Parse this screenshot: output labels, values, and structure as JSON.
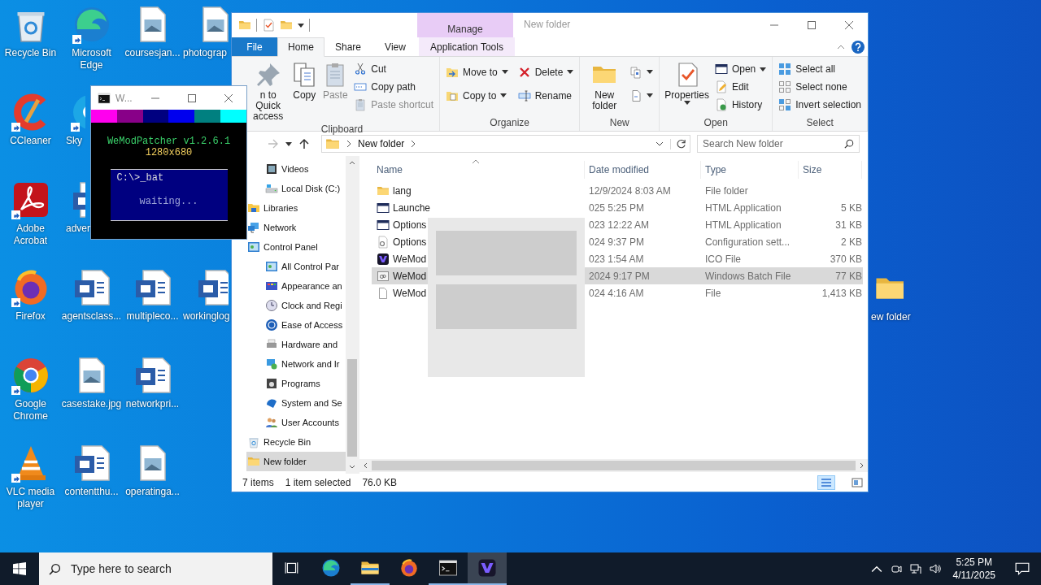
{
  "desktop": {
    "icons": [
      {
        "kind": "recycle",
        "label": "Recycle Bin",
        "shortcut": false
      },
      {
        "kind": "edge",
        "label": "Microsoft Edge",
        "shortcut": true
      },
      {
        "kind": "image",
        "label": "coursesjan...",
        "shortcut": false
      },
      {
        "kind": "image",
        "label": "photograp",
        "shortcut": false
      },
      {
        "kind": "ccleaner",
        "label": "CCleaner",
        "shortcut": true
      },
      {
        "kind": "skype",
        "label": "Sky",
        "shortcut": true
      },
      {
        "kind": "acrobat",
        "label": "Adobe Acrobat",
        "shortcut": true
      },
      {
        "kind": "word",
        "label": "adver",
        "shortcut": false
      },
      {
        "kind": "firefox",
        "label": "Firefox",
        "shortcut": true
      },
      {
        "kind": "word",
        "label": "agentsclass...",
        "shortcut": false
      },
      {
        "kind": "word",
        "label": "multipleco...",
        "shortcut": false
      },
      {
        "kind": "word",
        "label": "workinglog",
        "shortcut": false
      },
      {
        "kind": "chrome",
        "label": "Google Chrome",
        "shortcut": true
      },
      {
        "kind": "image",
        "label": "casestake.jpg",
        "shortcut": false
      },
      {
        "kind": "word",
        "label": "networkpri...",
        "shortcut": false
      },
      {
        "kind": "vlc",
        "label": "VLC media player",
        "shortcut": true
      },
      {
        "kind": "word",
        "label": "contentthu...",
        "shortcut": false
      },
      {
        "kind": "image",
        "label": "operatinga...",
        "shortcut": false
      }
    ],
    "side_icon": {
      "kind": "folder",
      "label": "ew folder"
    }
  },
  "explorer": {
    "title": "New folder",
    "contextual_tab": "Manage",
    "tabs": [
      {
        "kind": "file",
        "label": "File",
        "selected": false
      },
      {
        "kind": "normal",
        "label": "Home",
        "selected": true
      },
      {
        "kind": "normal",
        "label": "Share",
        "selected": false
      },
      {
        "kind": "normal",
        "label": "View",
        "selected": false
      },
      {
        "kind": "contextual",
        "label": "Application Tools",
        "selected": false
      }
    ],
    "ribbon": [
      {
        "label": "Clipboard",
        "commands": [
          {
            "kind": "pin",
            "label": "n to Quick access",
            "disabled": false,
            "dropdown": false
          },
          {
            "kind": "copy",
            "label": "Copy",
            "disabled": false,
            "dropdown": false
          },
          {
            "kind": "paste",
            "label": "Paste",
            "disabled": true,
            "dropdown": false
          },
          {
            "kind": "cut",
            "label": "Cut",
            "disabled": false,
            "dropdown": false
          },
          {
            "kind": "copypath",
            "label": "Copy path",
            "disabled": false,
            "dropdown": false
          },
          {
            "kind": "pasteshortcut",
            "label": "Paste shortcut",
            "disabled": true,
            "dropdown": false
          }
        ]
      },
      {
        "label": "Organize",
        "commands": [
          {
            "kind": "moveto",
            "label": "Move to",
            "disabled": false,
            "dropdown": true
          },
          {
            "kind": "copyto",
            "label": "Copy to",
            "disabled": false,
            "dropdown": true
          },
          {
            "kind": "delete",
            "label": "Delete",
            "disabled": false,
            "dropdown": true
          },
          {
            "kind": "rename",
            "label": "Rename",
            "disabled": false,
            "dropdown": false
          }
        ]
      },
      {
        "label": "New",
        "commands": [
          {
            "kind": "newfolder",
            "label": "New folder",
            "disabled": false,
            "dropdown": false
          },
          {
            "kind": "newitem",
            "disabled": false,
            "dropdown": true
          },
          {
            "kind": "easyaccess",
            "disabled": false,
            "dropdown": true
          }
        ]
      },
      {
        "label": "Open",
        "commands": [
          {
            "kind": "properties",
            "label": "Properties",
            "disabled": false,
            "dropdown": true
          },
          {
            "kind": "open",
            "label": "Open",
            "disabled": false,
            "dropdown": true
          },
          {
            "kind": "edit",
            "label": "Edit",
            "disabled": false,
            "dropdown": false
          },
          {
            "kind": "history",
            "label": "History",
            "disabled": false,
            "dropdown": false
          }
        ]
      },
      {
        "label": "Select",
        "commands": [
          {
            "kind": "selectall",
            "label": "Select all",
            "disabled": false,
            "dropdown": false
          },
          {
            "kind": "selectnone",
            "label": "Select none",
            "disabled": false,
            "dropdown": false
          },
          {
            "kind": "invert",
            "label": "Invert selection",
            "disabled": false,
            "dropdown": false
          }
        ]
      }
    ],
    "forward_disabled": true,
    "address": [
      "New folder"
    ],
    "search": {
      "placeholder": "Search New folder"
    },
    "navigation": [
      {
        "children": [
          {
            "kind": "videos",
            "label": "Videos",
            "selected": false
          },
          {
            "kind": "drive",
            "label": "Local Disk (C:)",
            "selected": false
          }
        ]
      },
      {
        "kind": "libraries",
        "label": "Libraries",
        "selected": false
      },
      {
        "kind": "network",
        "label": "Network",
        "selected": false
      },
      {
        "kind": "controlpanel",
        "label": "Control Panel",
        "selected": false,
        "children": [
          {
            "kind": "controlpanel",
            "label": "All Control Par",
            "selected": false
          },
          {
            "kind": "appearance",
            "label": "Appearance an",
            "selected": false
          },
          {
            "kind": "clock",
            "label": "Clock and Regi",
            "selected": false
          },
          {
            "kind": "ease",
            "label": "Ease of Access",
            "selected": false
          },
          {
            "kind": "hardware",
            "label": "Hardware and",
            "selected": false
          },
          {
            "kind": "netinternet",
            "label": "Network and Ir",
            "selected": false
          },
          {
            "kind": "programs",
            "label": "Programs",
            "selected": false
          },
          {
            "kind": "system",
            "label": "System and Se",
            "selected": false
          },
          {
            "kind": "users",
            "label": "User Accounts",
            "selected": false
          }
        ]
      },
      {
        "kind": "recycle",
        "label": "Recycle Bin",
        "selected": false
      },
      {
        "kind": "folder",
        "label": "New folder",
        "selected": true
      }
    ],
    "columns": [
      {
        "label": "Name",
        "sorted": true
      },
      {
        "label": "Date modified",
        "sorted": false
      },
      {
        "label": "Type",
        "sorted": false
      },
      {
        "label": "Size",
        "sorted": false
      }
    ],
    "files": [
      {
        "kind": "folder",
        "name": "lang",
        "date": "12/9/2024 8:03 AM",
        "type": "File folder",
        "selected": false
      },
      {
        "kind": "hta",
        "name": "Launche",
        "date": "025 5:25 PM",
        "type": "HTML Application",
        "size": "5 KB",
        "selected": false
      },
      {
        "kind": "hta",
        "name": "Options",
        "date": "023 12:22 AM",
        "type": "HTML Application",
        "size": "31 KB",
        "selected": false
      },
      {
        "kind": "config",
        "name": "Options",
        "date": "024 9:37 PM",
        "type": "Configuration sett...",
        "size": "2 KB",
        "selected": false
      },
      {
        "kind": "wemod",
        "name": "WeMod",
        "date": "023 1:54 AM",
        "type": "ICO File",
        "size": "370 KB",
        "selected": false
      },
      {
        "kind": "bat",
        "name": "WeMod",
        "date": "2024 9:17 PM",
        "type": "Windows Batch File",
        "size": "77 KB",
        "selected": true
      },
      {
        "kind": "file",
        "name": "WeMod",
        "date": "024 4:16 AM",
        "type": "File",
        "size": "1,413 KB",
        "selected": false
      }
    ],
    "preview_popup": {
      "shown": true
    },
    "status": {
      "count": "7 items",
      "selection": "1 item selected",
      "selection_size": "76.0 KB"
    },
    "views": [
      {
        "kind": "details",
        "selected": true
      },
      {
        "kind": "large",
        "selected": false
      }
    ]
  },
  "console": {
    "title": "W...",
    "palette": [
      {
        "color": "#ff00ee"
      },
      {
        "color": "#880088"
      },
      {
        "color": "#000080"
      },
      {
        "color": "#0000ee"
      },
      {
        "color": "#008080"
      },
      {
        "color": "#00ffff"
      }
    ],
    "heading": "WeModPatcher v1.2.6.1",
    "resolution": "1280x680",
    "prompt": "C:\\>_bat",
    "status": "waiting..."
  },
  "taskbar": {
    "search": {
      "placeholder": "Type here to search"
    },
    "apps": [
      {
        "kind": "edge",
        "running": false,
        "selected": false
      },
      {
        "kind": "explorer",
        "running": true,
        "selected": false
      },
      {
        "kind": "firefox",
        "running": false,
        "selected": false
      },
      {
        "kind": "cmd",
        "running": true,
        "selected": false
      },
      {
        "kind": "wemod",
        "running": true,
        "selected": true
      }
    ],
    "time": "5:25 PM",
    "date": "4/11/2025"
  }
}
